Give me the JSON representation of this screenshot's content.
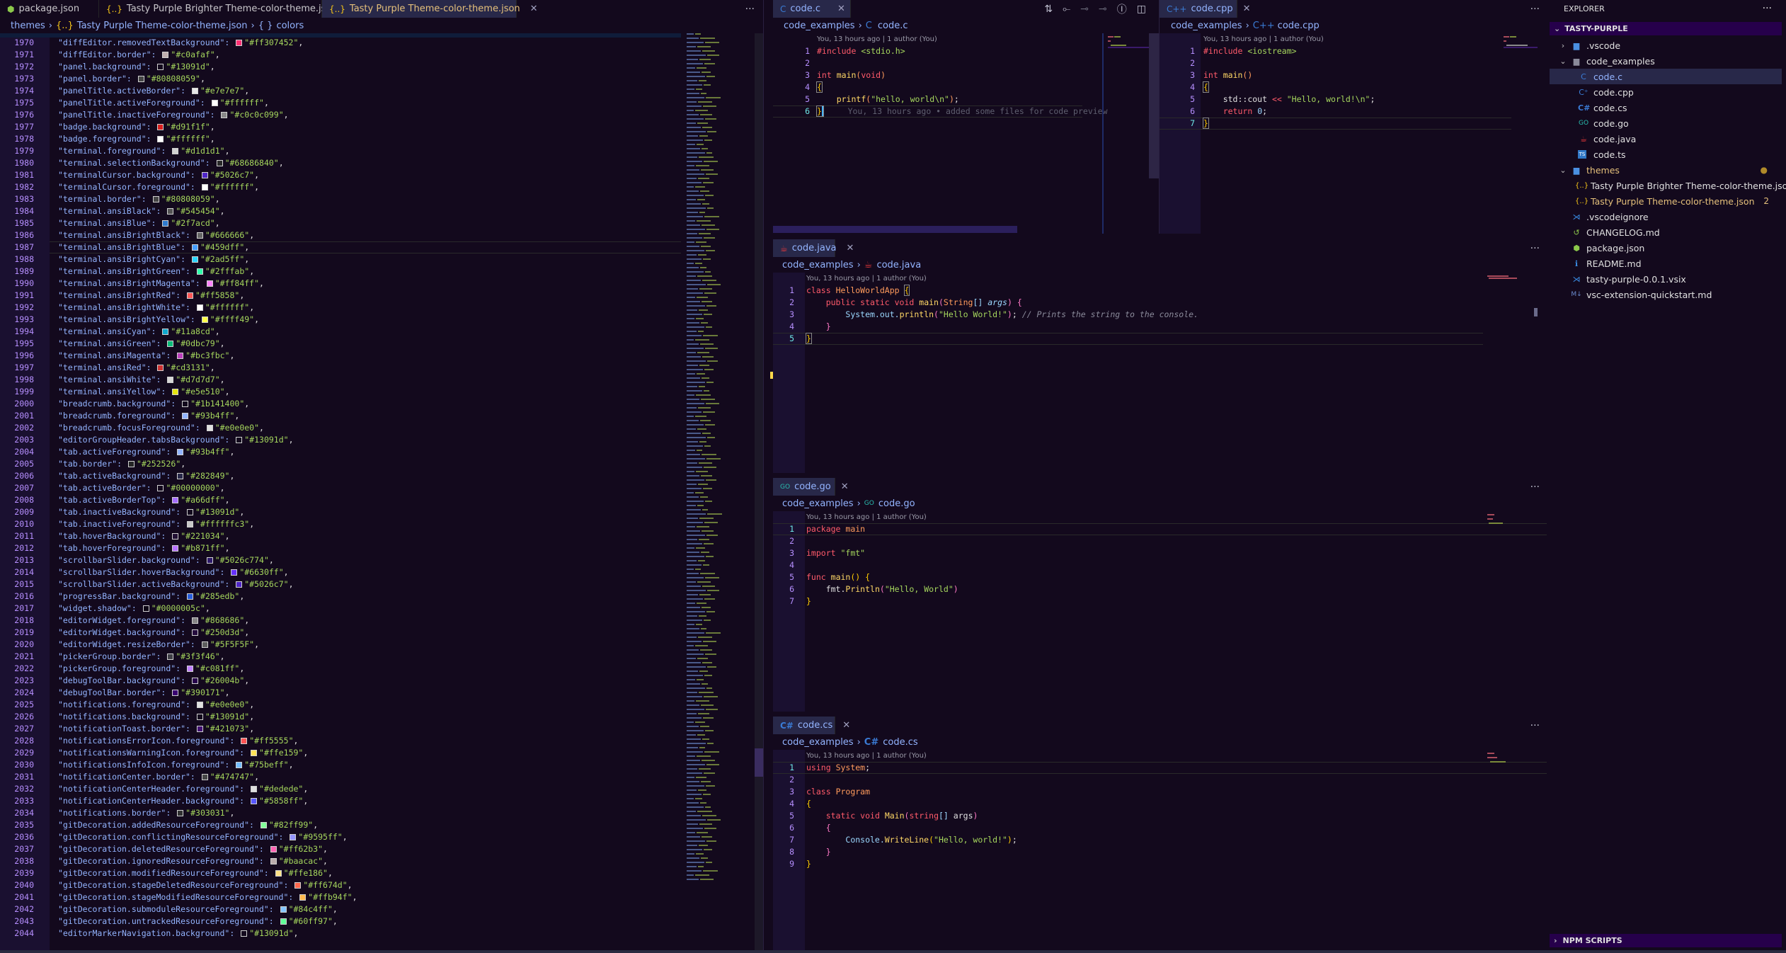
{
  "theme": {
    "bg": "#13091d",
    "accent": "#93b4ff",
    "active_tab_bg": "#282849",
    "section_header_bg": "#26004b"
  },
  "json_editor": {
    "tabs": [
      {
        "label": "package.json",
        "icon": "nodejs-icon"
      },
      {
        "label": "Tasty Purple Brighter Theme-color-theme.json",
        "icon": "json-braces-icon"
      },
      {
        "label": "Tasty Purple Theme-color-theme.json",
        "icon": "json-braces-icon",
        "active": true
      }
    ],
    "more_label": "···",
    "breadcrumb": {
      "folder": "themes",
      "file": "Tasty Purple Theme-color-theme.json",
      "symbol_icon": "{ }",
      "symbol": "colors"
    },
    "current_line": 1987,
    "lines": [
      {
        "n": 1970,
        "key": "diffEditor.removedTextBackground",
        "val": "#ff307452",
        "sw": "#ff3074"
      },
      {
        "n": 1971,
        "key": "diffEditor.border",
        "val": "#c0afaf",
        "sw": "#c0afaf"
      },
      {
        "n": 1972,
        "key": "panel.background",
        "val": "#13091d",
        "sw": "#13091d"
      },
      {
        "n": 1973,
        "key": "panel.border",
        "val": "#80808059",
        "sw": "#454545"
      },
      {
        "n": 1974,
        "key": "panelTitle.activeBorder",
        "val": "#e7e7e7",
        "sw": "#e7e7e7"
      },
      {
        "n": 1975,
        "key": "panelTitle.activeForeground",
        "val": "#ffffff",
        "sw": "#ffffff"
      },
      {
        "n": 1976,
        "key": "panelTitle.inactiveForeground",
        "val": "#c0c0c099",
        "sw": "#8a8a8a"
      },
      {
        "n": 1977,
        "key": "badge.background",
        "val": "#d91f1f",
        "sw": "#d91f1f"
      },
      {
        "n": 1978,
        "key": "badge.foreground",
        "val": "#ffffff",
        "sw": "#ffffff"
      },
      {
        "n": 1979,
        "key": "terminal.foreground",
        "val": "#d1d1d1",
        "sw": "#d1d1d1"
      },
      {
        "n": 1980,
        "key": "terminal.selectionBackground",
        "val": "#68686840",
        "sw": "#2a2a2a"
      },
      {
        "n": 1981,
        "key": "terminalCursor.background",
        "val": "#5026c7",
        "sw": "#5026c7"
      },
      {
        "n": 1982,
        "key": "terminalCursor.foreground",
        "val": "#ffffff",
        "sw": "#ffffff"
      },
      {
        "n": 1983,
        "key": "terminal.border",
        "val": "#80808059",
        "sw": "#454545"
      },
      {
        "n": 1984,
        "key": "terminal.ansiBlack",
        "val": "#545454",
        "sw": "#545454"
      },
      {
        "n": 1985,
        "key": "terminal.ansiBlue",
        "val": "#2f7acd",
        "sw": "#2f7acd"
      },
      {
        "n": 1986,
        "key": "terminal.ansiBrightBlack",
        "val": "#666666",
        "sw": "#666666"
      },
      {
        "n": 1987,
        "key": "terminal.ansiBrightBlue",
        "val": "#459dff",
        "sw": "#459dff"
      },
      {
        "n": 1988,
        "key": "terminal.ansiBrightCyan",
        "val": "#2ad5ff",
        "sw": "#2ad5ff"
      },
      {
        "n": 1989,
        "key": "terminal.ansiBrightGreen",
        "val": "#2fffab",
        "sw": "#2fffab"
      },
      {
        "n": 1990,
        "key": "terminal.ansiBrightMagenta",
        "val": "#ff84ff",
        "sw": "#ff84ff"
      },
      {
        "n": 1991,
        "key": "terminal.ansiBrightRed",
        "val": "#ff5858",
        "sw": "#ff5858"
      },
      {
        "n": 1992,
        "key": "terminal.ansiBrightWhite",
        "val": "#ffffff",
        "sw": "#ffffff"
      },
      {
        "n": 1993,
        "key": "terminal.ansiBrightYellow",
        "val": "#ffff49",
        "sw": "#ffff49"
      },
      {
        "n": 1994,
        "key": "terminal.ansiCyan",
        "val": "#11a8cd",
        "sw": "#11a8cd"
      },
      {
        "n": 1995,
        "key": "terminal.ansiGreen",
        "val": "#0dbc79",
        "sw": "#0dbc79"
      },
      {
        "n": 1996,
        "key": "terminal.ansiMagenta",
        "val": "#bc3fbc",
        "sw": "#bc3fbc"
      },
      {
        "n": 1997,
        "key": "terminal.ansiRed",
        "val": "#cd3131",
        "sw": "#cd3131"
      },
      {
        "n": 1998,
        "key": "terminal.ansiWhite",
        "val": "#d7d7d7",
        "sw": "#d7d7d7"
      },
      {
        "n": 1999,
        "key": "terminal.ansiYellow",
        "val": "#e5e510",
        "sw": "#e5e510"
      },
      {
        "n": 2000,
        "key": "breadcrumb.background",
        "val": "#1b141400",
        "sw": "#13091d"
      },
      {
        "n": 2001,
        "key": "breadcrumb.foreground",
        "val": "#93b4ff",
        "sw": "#93b4ff"
      },
      {
        "n": 2002,
        "key": "breadcrumb.focusForeground",
        "val": "#e0e0e0",
        "sw": "#e0e0e0"
      },
      {
        "n": 2003,
        "key": "editorGroupHeader.tabsBackground",
        "val": "#13091d",
        "sw": "#13091d"
      },
      {
        "n": 2004,
        "key": "tab.activeForeground",
        "val": "#93b4ff",
        "sw": "#93b4ff"
      },
      {
        "n": 2005,
        "key": "tab.border",
        "val": "#252526",
        "sw": "#252526"
      },
      {
        "n": 2006,
        "key": "tab.activeBackground",
        "val": "#282849",
        "sw": "#282849"
      },
      {
        "n": 2007,
        "key": "tab.activeBorder",
        "val": "#00000000",
        "sw": "#13091d"
      },
      {
        "n": 2008,
        "key": "tab.activeBorderTop",
        "val": "#a66dff",
        "sw": "#a66dff"
      },
      {
        "n": 2009,
        "key": "tab.inactiveBackground",
        "val": "#13091d",
        "sw": "#13091d"
      },
      {
        "n": 2010,
        "key": "tab.inactiveForeground",
        "val": "#ffffffc3",
        "sw": "#c8c8c8"
      },
      {
        "n": 2011,
        "key": "tab.hoverBackground",
        "val": "#221034",
        "sw": "#221034"
      },
      {
        "n": 2012,
        "key": "tab.hoverForeground",
        "val": "#b871ff",
        "sw": "#b871ff"
      },
      {
        "n": 2013,
        "key": "scrollbarSlider.background",
        "val": "#5026c774",
        "sw": "#2e1a6a"
      },
      {
        "n": 2014,
        "key": "scrollbarSlider.hoverBackground",
        "val": "#6630ff",
        "sw": "#6630ff"
      },
      {
        "n": 2015,
        "key": "scrollbarSlider.activeBackground",
        "val": "#5026c7",
        "sw": "#5026c7"
      },
      {
        "n": 2016,
        "key": "progressBar.background",
        "val": "#285edb",
        "sw": "#285edb"
      },
      {
        "n": 2017,
        "key": "widget.shadow",
        "val": "#0000005c",
        "sw": "#0d0614"
      },
      {
        "n": 2018,
        "key": "editorWidget.foreground",
        "val": "#868686",
        "sw": "#868686"
      },
      {
        "n": 2019,
        "key": "editorWidget.background",
        "val": "#250d3d",
        "sw": "#250d3d"
      },
      {
        "n": 2020,
        "key": "editorWidget.resizeBorder",
        "val": "#5F5F5F",
        "sw": "#5f5f5f"
      },
      {
        "n": 2021,
        "key": "pickerGroup.border",
        "val": "#3f3f46",
        "sw": "#3f3f46"
      },
      {
        "n": 2022,
        "key": "pickerGroup.foreground",
        "val": "#c081ff",
        "sw": "#c081ff"
      },
      {
        "n": 2023,
        "key": "debugToolBar.background",
        "val": "#26004b",
        "sw": "#26004b"
      },
      {
        "n": 2024,
        "key": "debugToolBar.border",
        "val": "#390171",
        "sw": "#390171"
      },
      {
        "n": 2025,
        "key": "notifications.foreground",
        "val": "#e0e0e0",
        "sw": "#e0e0e0"
      },
      {
        "n": 2026,
        "key": "notifications.background",
        "val": "#13091d",
        "sw": "#13091d"
      },
      {
        "n": 2027,
        "key": "notificationToast.border",
        "val": "#421073",
        "sw": "#421073"
      },
      {
        "n": 2028,
        "key": "notificationsErrorIcon.foreground",
        "val": "#ff5555",
        "sw": "#ff5555"
      },
      {
        "n": 2029,
        "key": "notificationsWarningIcon.foreground",
        "val": "#ffe159",
        "sw": "#ffe159"
      },
      {
        "n": 2030,
        "key": "notificationsInfoIcon.foreground",
        "val": "#75beff",
        "sw": "#75beff"
      },
      {
        "n": 2031,
        "key": "notificationCenter.border",
        "val": "#474747",
        "sw": "#474747"
      },
      {
        "n": 2032,
        "key": "notificationCenterHeader.foreground",
        "val": "#dedede",
        "sw": "#dedede"
      },
      {
        "n": 2033,
        "key": "notificationCenterHeader.background",
        "val": "#5858ff",
        "sw": "#5858ff"
      },
      {
        "n": 2034,
        "key": "notifications.border",
        "val": "#303031",
        "sw": "#303031"
      },
      {
        "n": 2035,
        "key": "gitDecoration.addedResourceForeground",
        "val": "#82ff99",
        "sw": "#82ff99"
      },
      {
        "n": 2036,
        "key": "gitDecoration.conflictingResourceForeground",
        "val": "#9595ff",
        "sw": "#9595ff"
      },
      {
        "n": 2037,
        "key": "gitDecoration.deletedResourceForeground",
        "val": "#ff62b3",
        "sw": "#ff62b3"
      },
      {
        "n": 2038,
        "key": "gitDecoration.ignoredResourceForeground",
        "val": "#baacac",
        "sw": "#baacac"
      },
      {
        "n": 2039,
        "key": "gitDecoration.modifiedResourceForeground",
        "val": "#ffe186",
        "sw": "#ffe186"
      },
      {
        "n": 2040,
        "key": "gitDecoration.stageDeletedResourceForeground",
        "val": "#ff674d",
        "sw": "#ff674d"
      },
      {
        "n": 2041,
        "key": "gitDecoration.stageModifiedResourceForeground",
        "val": "#ffb94f",
        "sw": "#ffb94f"
      },
      {
        "n": 2042,
        "key": "gitDecoration.submoduleResourceForeground",
        "val": "#84c4ff",
        "sw": "#84c4ff"
      },
      {
        "n": 2043,
        "key": "gitDecoration.untrackedResourceForeground",
        "val": "#60ff97",
        "sw": "#60ff97"
      },
      {
        "n": 2044,
        "key": "editorMarkerNavigation.background",
        "val": "#13091d",
        "sw": "#13091d"
      }
    ]
  },
  "code_c": {
    "tab": "code.c",
    "tab_icon": "C",
    "breadcrumb_folder": "code_examples",
    "breadcrumb_file": "code.c",
    "lens": "You, 13 hours ago | 1 author (You)",
    "blame": "You, 13 hours ago • added some files for code preview",
    "toolbar": [
      "open-changes-icon",
      "previous-change-icon",
      "revision-icon",
      "next-change-icon",
      "git-graph-icon",
      "split-editor-icon"
    ],
    "current_line": 6
  },
  "code_cpp": {
    "tab": "code.cpp",
    "tab_icon": "C++",
    "breadcrumb_folder": "code_examples",
    "breadcrumb_file": "code.cpp",
    "lens": "You, 13 hours ago | 1 author (You)",
    "current_line": 7
  },
  "code_java": {
    "tab": "code.java",
    "breadcrumb_folder": "code_examples",
    "breadcrumb_file": "code.java",
    "lens": "You, 13 hours ago | 1 author (You)",
    "current_line": 5
  },
  "code_go": {
    "tab": "code.go",
    "tab_icon": "GO",
    "breadcrumb_folder": "code_examples",
    "breadcrumb_file": "code.go",
    "lens": "You, 13 hours ago | 1 author (You)",
    "current_line": 1
  },
  "code_cs": {
    "tab": "code.cs",
    "tab_icon": "C#",
    "breadcrumb_folder": "code_examples",
    "breadcrumb_file": "code.cs",
    "lens": "You, 13 hours ago | 1 author (You)",
    "current_line": 1
  },
  "explorer": {
    "title": "EXPLORER",
    "more": "···",
    "root": "TASTY-PURPLE",
    "items": [
      {
        "label": ".vscode",
        "type": "folder",
        "collapsed": true
      },
      {
        "label": "code_examples",
        "type": "folder",
        "collapsed": false
      },
      {
        "label": "code.c",
        "type": "file",
        "selected": true
      },
      {
        "label": "code.cpp",
        "type": "file"
      },
      {
        "label": "code.cs",
        "type": "file"
      },
      {
        "label": "code.go",
        "type": "file"
      },
      {
        "label": "code.java",
        "type": "file"
      },
      {
        "label": "code.ts",
        "type": "file"
      },
      {
        "label": "themes",
        "type": "folder",
        "collapsed": false,
        "modified": true
      },
      {
        "label": "Tasty Purple Brighter Theme-color-theme.json",
        "type": "file"
      },
      {
        "label": "Tasty Purple Theme-color-theme.json",
        "type": "file",
        "modified": true,
        "badge": "2"
      },
      {
        "label": ".vscodeignore",
        "type": "file"
      },
      {
        "label": "CHANGELOG.md",
        "type": "file"
      },
      {
        "label": "package.json",
        "type": "file"
      },
      {
        "label": "README.md",
        "type": "file"
      },
      {
        "label": "tasty-purple-0.0.1.vsix",
        "type": "file"
      },
      {
        "label": "vsc-extension-quickstart.md",
        "type": "file"
      }
    ],
    "npm_scripts": "NPM SCRIPTS"
  }
}
